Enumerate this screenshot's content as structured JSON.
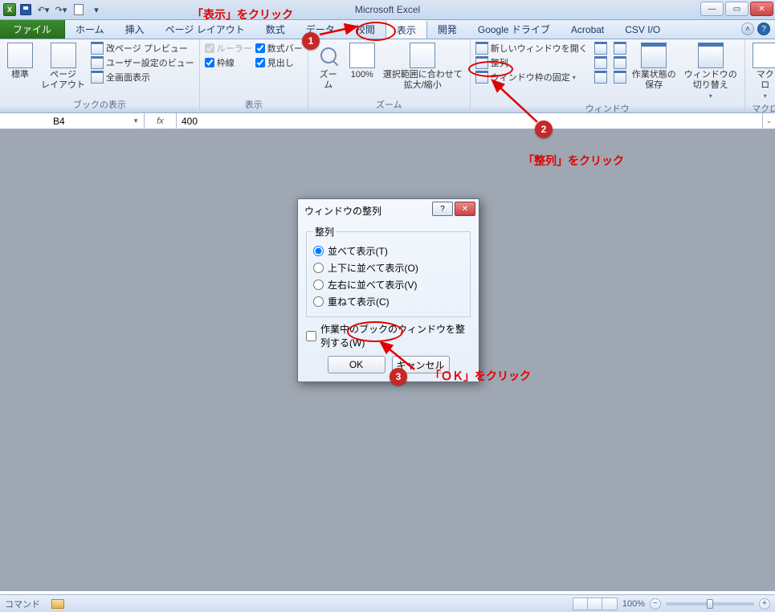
{
  "app_title": "Microsoft Excel",
  "tabs": {
    "file": "ファイル",
    "home": "ホーム",
    "insert": "挿入",
    "pagelayout": "ページ レイアウト",
    "formulas": "数式",
    "data": "データ",
    "review": "校閲",
    "view": "表示",
    "developer": "開発",
    "gdrive": "Google ドライブ",
    "acrobat": "Acrobat",
    "csvio": "CSV I/O"
  },
  "ribbon": {
    "workbook_views": {
      "label": "ブックの表示",
      "normal": "標準",
      "pagelayout": "ページ\nレイアウト",
      "pagebreak": "改ページ プレビュー",
      "custom": "ユーザー設定のビュー",
      "fullscreen": "全画面表示"
    },
    "show": {
      "label": "表示",
      "ruler": "ルーラー",
      "fbar": "数式バー",
      "gridlines": "枠線",
      "headings": "見出し"
    },
    "zoom": {
      "label": "ズーム",
      "zoom": "ズーム",
      "pct100": "100%",
      "selection": "選択範囲に合わせて\n拡大/縮小"
    },
    "window": {
      "label": "ウィンドウ",
      "new": "新しいウィンドウを開く",
      "arrange": "整列",
      "freeze": "ウィンドウ枠の固定",
      "save_ws": "作業状態の\n保存",
      "switch": "ウィンドウの\n切り替え"
    },
    "macros": {
      "label": "マクロ",
      "btn": "マクロ"
    }
  },
  "formula_bar": {
    "cell": "B4",
    "fx": "fx",
    "value": "400"
  },
  "dialog": {
    "title": "ウィンドウの整列",
    "group": "整列",
    "tiled": "並べて表示(T)",
    "horizontal": "上下に並べて表示(O)",
    "vertical": "左右に並べて表示(V)",
    "cascade": "重ねて表示(C)",
    "active_only": "作業中のブックのウィンドウを整列する(W)",
    "ok": "OK",
    "cancel": "キャンセル"
  },
  "statusbar": {
    "mode": "コマンド",
    "zoom": "100%"
  },
  "annotations": {
    "a1": "「表示」をクリック",
    "a2": "「整列」をクリック",
    "a3": "「ＯＫ」をクリック"
  }
}
